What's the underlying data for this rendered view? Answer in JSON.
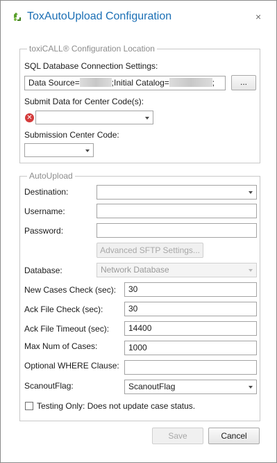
{
  "window": {
    "title": "ToxAutoUpload Configuration",
    "close_glyph": "×"
  },
  "config_location": {
    "legend": "toxiCALL® Configuration Location",
    "sql_label": "SQL Database Connection Settings:",
    "conn_prefix": "Data Source=",
    "conn_middle": ";Initial Catalog=",
    "conn_suffix": ";",
    "browse_label": "...",
    "center_codes_label": "Submit Data for Center Code(s):",
    "center_codes_value": "",
    "submission_label": "Submission Center Code:",
    "submission_value": ""
  },
  "autoupload": {
    "legend": "AutoUpload",
    "destination_label": "Destination:",
    "destination_value": "",
    "username_label": "Username:",
    "username_value": "",
    "password_label": "Password:",
    "password_value": "",
    "advanced_label": "Advanced SFTP Settings...",
    "database_label": "Database:",
    "database_value": "Network Database",
    "new_cases_label": "New Cases Check (sec):",
    "new_cases_value": "30",
    "ack_check_label": "Ack File Check (sec):",
    "ack_check_value": "30",
    "ack_timeout_label": "Ack File Timeout (sec):",
    "ack_timeout_value": "14400",
    "max_cases_label": "Max Num of Cases:",
    "max_cases_value": "1000",
    "where_label": "Optional WHERE Clause:",
    "where_value": "",
    "scanout_label": "ScanoutFlag:",
    "scanout_value": "ScanoutFlag",
    "testing_label": "Testing Only: Does not update case status.",
    "testing_checked": false
  },
  "footer": {
    "save_label": "Save",
    "cancel_label": "Cancel"
  },
  "icons": {
    "app": "recycle-upload-icon",
    "error": "error-icon",
    "close": "close-icon"
  },
  "colors": {
    "title": "#1b6fb5",
    "legend": "#8c8c8c",
    "error": "#d43b3b"
  }
}
